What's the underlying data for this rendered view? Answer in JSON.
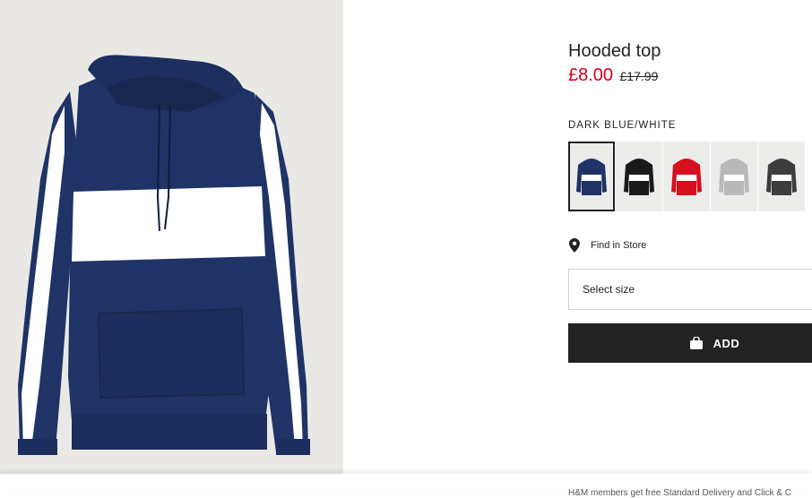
{
  "product": {
    "title": "Hooded top",
    "sale_price": "£8.00",
    "original_price": "£17.99"
  },
  "colors": {
    "selected_name": "DARK BLUE/WHITE",
    "swatches": [
      {
        "hex": "#1f3366",
        "selected": true
      },
      {
        "hex": "#1a1a1a",
        "selected": false
      },
      {
        "hex": "#d6101e",
        "selected": false
      },
      {
        "hex": "#b9b9b9",
        "selected": false
      },
      {
        "hex": "#3d3d3d",
        "selected": false
      }
    ]
  },
  "store": {
    "icon": "location-pin-icon",
    "label": "Find in Store"
  },
  "size": {
    "placeholder": "Select size"
  },
  "cart": {
    "icon": "shopping-bag-icon",
    "label": "ADD"
  },
  "footer": {
    "text": "H&M members get free Standard Delivery and Click & C"
  },
  "theme": {
    "accent_price": "#d0021b",
    "button_bg": "#222222",
    "hoodie_navy": "#1f3366"
  }
}
